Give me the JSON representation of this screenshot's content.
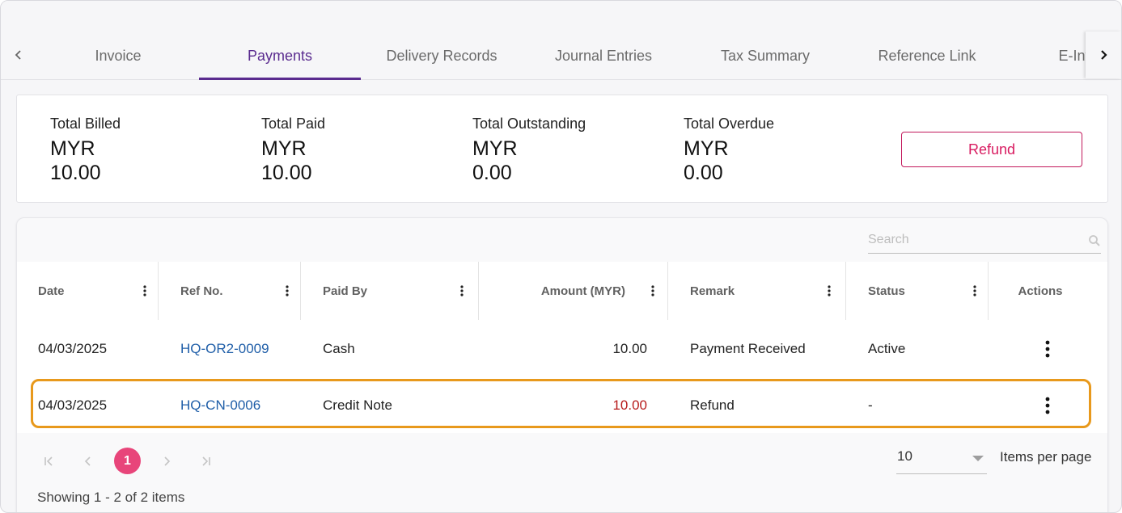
{
  "tabs": [
    {
      "label": "Invoice",
      "active": false
    },
    {
      "label": "Payments",
      "active": true
    },
    {
      "label": "Delivery Records",
      "active": false
    },
    {
      "label": "Journal Entries",
      "active": false
    },
    {
      "label": "Tax Summary",
      "active": false
    },
    {
      "label": "Reference Link",
      "active": false
    },
    {
      "label": "E-Invoice",
      "active": false
    }
  ],
  "summary": {
    "total_billed": {
      "label": "Total Billed",
      "currency": "MYR",
      "amount": "10.00"
    },
    "total_paid": {
      "label": "Total Paid",
      "currency": "MYR",
      "amount": "10.00"
    },
    "total_outstanding": {
      "label": "Total Outstanding",
      "currency": "MYR",
      "amount": "0.00"
    },
    "total_overdue": {
      "label": "Total Overdue",
      "currency": "MYR",
      "amount": "0.00"
    },
    "refund_label": "Refund"
  },
  "search": {
    "placeholder": "Search",
    "value": ""
  },
  "table": {
    "columns": [
      "Date",
      "Ref No.",
      "Paid By",
      "Amount (MYR)",
      "Remark",
      "Status",
      "Actions"
    ],
    "rows": [
      {
        "date": "04/03/2025",
        "ref": "HQ-OR2-0009",
        "paid_by": "Cash",
        "amount": "10.00",
        "remark": "Payment Received",
        "status": "Active"
      },
      {
        "date": "04/03/2025",
        "ref": "HQ-CN-0006",
        "paid_by": "Credit Note",
        "amount": "10.00",
        "remark": "Refund",
        "status": "-"
      }
    ]
  },
  "pager": {
    "current_page": "1",
    "page_size": "10",
    "items_per_page_label": "Items per page",
    "showing": "Showing 1 - 2 of 2 items"
  },
  "colors": {
    "accent": "#5a2b8f",
    "refund": "#d81b60",
    "page_active": "#e8457a",
    "highlight": "#e8991c",
    "link": "#1f5ea8",
    "negative_amount": "#b71c1c"
  }
}
